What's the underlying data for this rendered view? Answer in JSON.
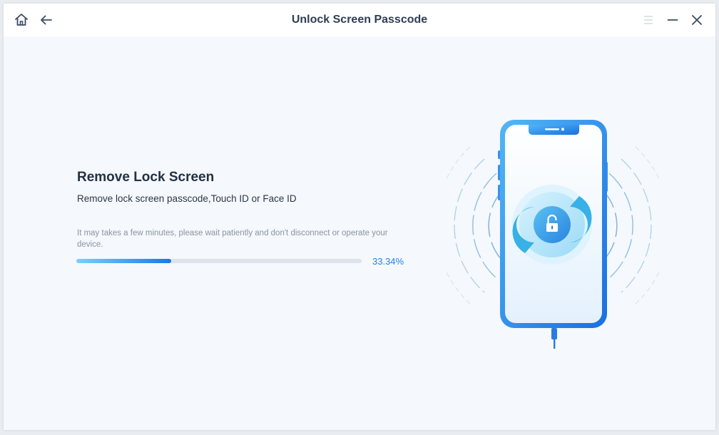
{
  "window": {
    "title": "Unlock Screen Passcode"
  },
  "titlebar": {
    "left_icons": [
      "home-icon",
      "back-arrow-icon"
    ],
    "right_icons": [
      "menu-icon",
      "minimize-icon",
      "close-icon"
    ]
  },
  "main": {
    "heading": "Remove Lock Screen",
    "subheading": "Remove lock screen passcode,Touch ID or Face ID",
    "note": "It may takes a few minutes, please wait patiently and don't disconnect or operate your device.",
    "progress": {
      "value": 33.34,
      "label": "33.34%"
    }
  },
  "illustration": {
    "icon": "unlock-icon"
  },
  "colors": {
    "accent": "#1e86e6",
    "title_text": "#2e3d55",
    "background": "#f5f8fc",
    "progress_track": "#dde3ec"
  }
}
